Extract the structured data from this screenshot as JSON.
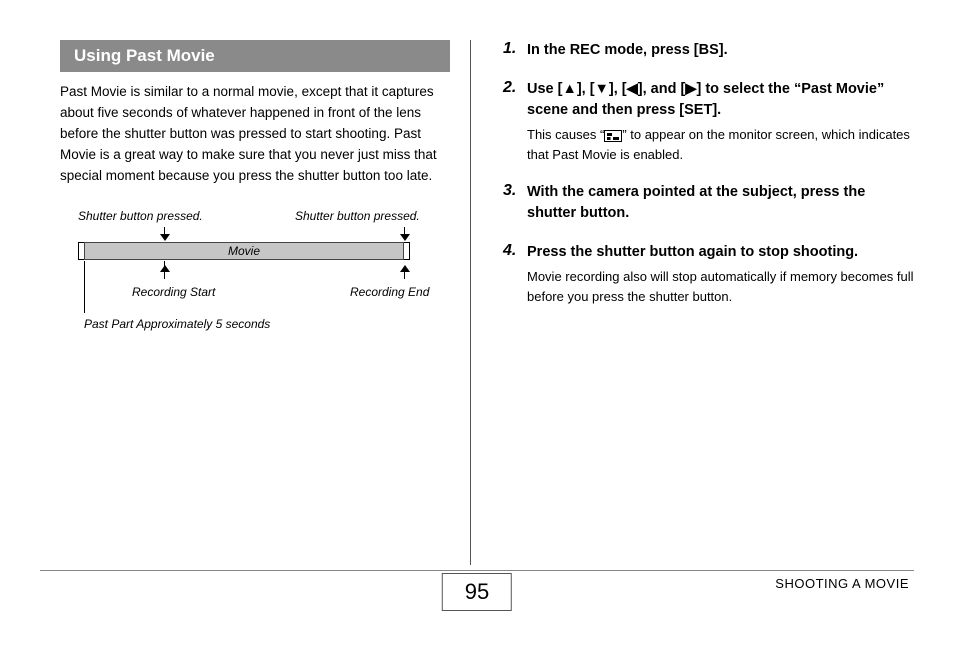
{
  "section_heading": "Using Past Movie",
  "intro_text": "Past Movie is similar to a normal movie, except that it captures about five seconds of whatever happened in front of the lens before the shutter button was pressed to start shooting. Past Movie is a great way to make sure that you never just miss that special moment because you press the shutter button too late.",
  "diagram": {
    "shutter_left": "Shutter button pressed.",
    "shutter_right": "Shutter button pressed.",
    "movie_label": "Movie",
    "recording_start": "Recording Start",
    "recording_end": "Recording End",
    "past_part": "Past Part Approximately 5 seconds"
  },
  "steps": [
    {
      "num": "1.",
      "head": "In the REC mode, press [BS].",
      "body": ""
    },
    {
      "num": "2.",
      "head_pre": "Use [",
      "head_mid1": "], [",
      "head_mid2": "], [",
      "head_mid3": "], and [",
      "head_post": "] to select the “Past Movie” scene and then press [SET].",
      "body_pre": "This causes “",
      "body_post": "” to appear on the monitor screen, which indicates that Past Movie is enabled."
    },
    {
      "num": "3.",
      "head": "With the camera pointed at the subject, press the shutter button.",
      "body": ""
    },
    {
      "num": "4.",
      "head": "Press the shutter button again to stop shooting.",
      "body": "Movie recording also will stop automatically if memory becomes full before you press the shutter button."
    }
  ],
  "footer_label": "SHOOTING A MOVIE",
  "page_number": "95"
}
